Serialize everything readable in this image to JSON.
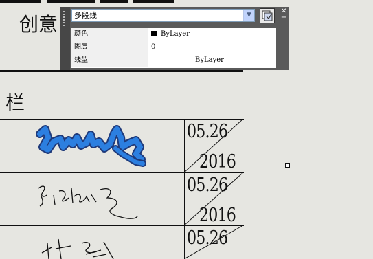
{
  "document": {
    "title_text": "创意",
    "section_text": "栏",
    "rows": [
      {
        "date": "05.26",
        "year": "2016"
      },
      {
        "date": "05.26",
        "year": "2016"
      },
      {
        "date": "05.26",
        "year": ""
      }
    ]
  },
  "palette": {
    "object_type": "多段线",
    "properties": [
      {
        "name": "颜色",
        "value": "ByLayer",
        "swatch": "#000000"
      },
      {
        "name": "图层",
        "value": "0"
      },
      {
        "name": "线型",
        "value": "ByLayer"
      }
    ]
  }
}
